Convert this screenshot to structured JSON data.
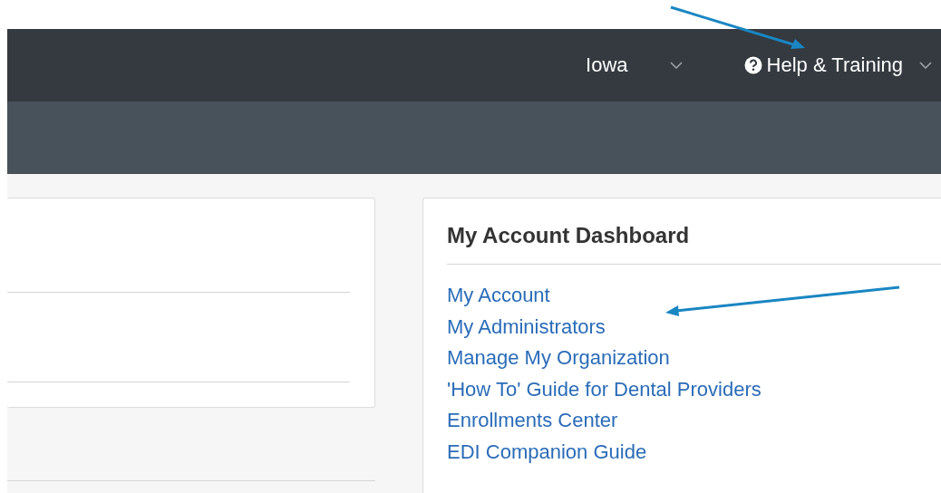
{
  "navbar": {
    "menus": [
      {
        "label": "Iowa",
        "kind": "plain"
      },
      {
        "label": "Help & Training",
        "kind": "help"
      }
    ]
  },
  "dashboard": {
    "title": "My Account Dashboard",
    "links": [
      "My Account",
      "My Administrators",
      "Manage My Organization",
      "'How To' Guide for Dental Providers",
      "Enrollments Center",
      "EDI Companion Guide"
    ]
  }
}
